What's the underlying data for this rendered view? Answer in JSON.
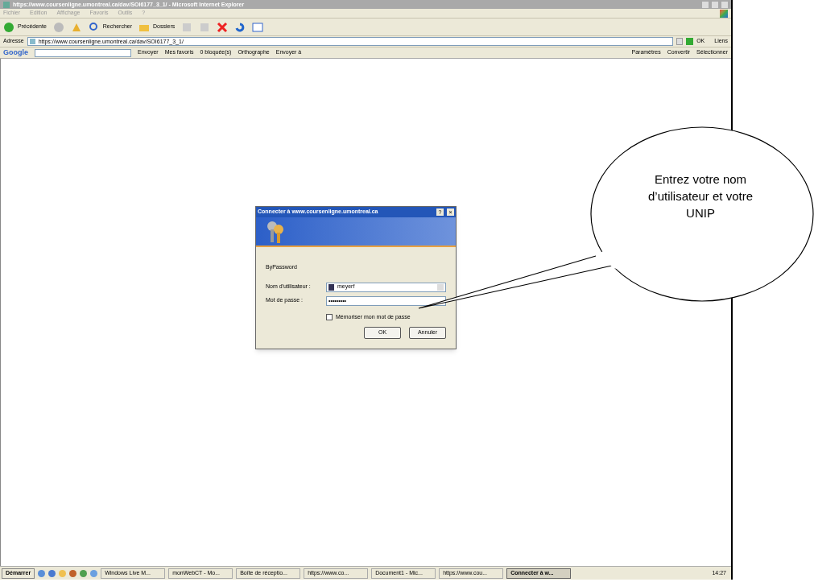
{
  "window": {
    "title": "https://www.coursenligne.umontreal.ca/dav/SOI6177_3_1/ - Microsoft Internet Explorer"
  },
  "menu": [
    "Fichier",
    "Edition",
    "Affichage",
    "Favoris",
    "Outils",
    "?"
  ],
  "toolbar": [
    {
      "kind": "back",
      "label": "Précédente"
    },
    {
      "kind": "forward"
    },
    {
      "kind": "up"
    },
    {
      "kind": "search",
      "label": "Rechercher"
    },
    {
      "kind": "folders",
      "label": "Dossiers"
    },
    {
      "kind": "tool"
    },
    {
      "kind": "tool"
    },
    {
      "kind": "stop"
    },
    {
      "kind": "undo"
    },
    {
      "kind": "view"
    }
  ],
  "address": {
    "label": "Adresse",
    "url": "https://www.coursenligne.umontreal.ca/dav/SOI6177_3_1/",
    "go": "OK",
    "links": "Liens"
  },
  "google_bar": {
    "logo": "Google",
    "left": [
      "Envoyer",
      "Mes favoris",
      "0 bloquée(s)",
      "Orthographe",
      "Envoyer à"
    ],
    "right": [
      "Paramètres",
      "Convertir",
      "Sélectionner"
    ]
  },
  "dialog": {
    "title": "Connecter à www.coursenligne.umontreal.ca",
    "help": "?",
    "close": "×",
    "realm": "ByPassword",
    "user_label": "Nom d'utilisateur :",
    "user": "meyerf",
    "password_label": "Mot de passe :",
    "password": "•••••••••",
    "remember": {
      "label": "Mémoriser mon mot de passe",
      "checked": false
    },
    "buttons": [
      "OK",
      "Annuler"
    ]
  },
  "callout": "Entrez votre nom d’utilisateur et votre UNIP",
  "taskbar": {
    "start": "Démarrer",
    "tasks": [
      {
        "label": "Windows Live M...",
        "selected": false
      },
      {
        "label": "monWebCT - Mo...",
        "selected": false
      },
      {
        "label": "Boîte de réceptio...",
        "selected": false
      },
      {
        "label": "https://www.co...",
        "selected": false
      },
      {
        "label": "Document1 - Mic...",
        "selected": false
      },
      {
        "label": "https://www.cou...",
        "selected": false
      },
      {
        "label": "Connecter à w...",
        "selected": true
      }
    ],
    "clock": "14:27"
  }
}
